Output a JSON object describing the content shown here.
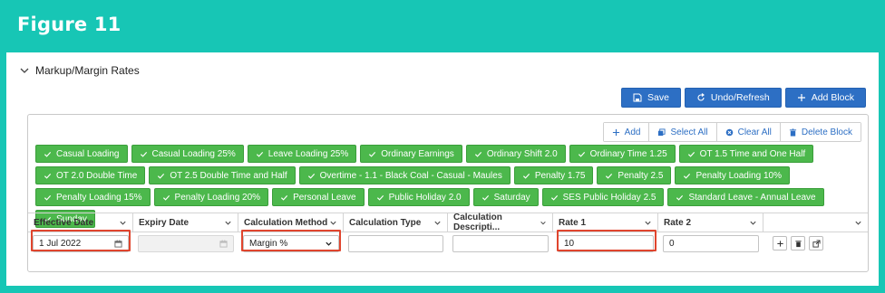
{
  "header": {
    "title": "Figure 11"
  },
  "section": {
    "title": "Markup/Margin Rates"
  },
  "actions": [
    {
      "label": "Save",
      "icon": "save-icon"
    },
    {
      "label": "Undo/Refresh",
      "icon": "undo-icon"
    },
    {
      "label": "Add Block",
      "icon": "plus-icon"
    }
  ],
  "card_actions": [
    {
      "label": "Add",
      "icon": "plus-icon"
    },
    {
      "label": "Select All",
      "icon": "select-all-icon"
    },
    {
      "label": "Clear All",
      "icon": "clear-icon"
    },
    {
      "label": "Delete Block",
      "icon": "trash-icon"
    }
  ],
  "chips": [
    "Casual Loading",
    "Casual Loading 25%",
    "Leave Loading 25%",
    "Ordinary Earnings",
    "Ordinary Shift 2.0",
    "Ordinary Time 1.25",
    "OT 1.5 Time and One Half",
    "OT 2.0 Double Time",
    "OT 2.5 Double Time and Half",
    "Overtime - 1.1 - Black Coal - Casual - Maules",
    "Penalty 1.75",
    "Penalty 2.5",
    "Penalty Loading 10%",
    "Penalty Loading 15%",
    "Penalty Loading 20%",
    "Personal Leave",
    "Public Holiday 2.0",
    "Saturday",
    "SES Public Holiday 2.5",
    "Standard Leave - Annual Leave",
    "Sunday"
  ],
  "columns": [
    "Effective Date",
    "Expiry Date",
    "Calculation Method",
    "Calculation Type",
    "Calculation Descripti...",
    "Rate 1",
    "Rate 2",
    ""
  ],
  "row": {
    "effective_date": "1 Jul 2022",
    "expiry_date": "",
    "calculation_method": "Margin %",
    "calculation_type": "",
    "calculation_description": "",
    "rate1": "10",
    "rate2": "0"
  },
  "colors": {
    "teal": "#17c6b5",
    "blue": "#2d6fc4",
    "green": "#4cb84c",
    "highlight": "#e0452e"
  }
}
